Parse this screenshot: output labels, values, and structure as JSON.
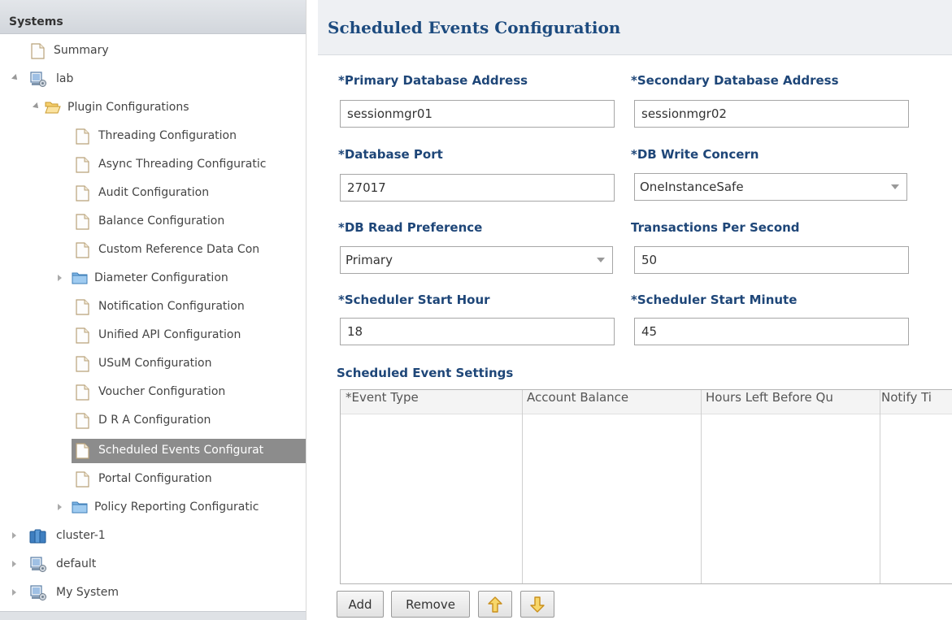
{
  "tree": {
    "header": "Systems",
    "items": [
      {
        "label": "Summary",
        "icon": "document-icon",
        "expander": "none"
      },
      {
        "label": "lab",
        "icon": "system-icon",
        "expander": "open"
      },
      {
        "label": "Plugin Configurations",
        "icon": "folder-open-icon",
        "expander": "open"
      },
      {
        "label": "Threading Configuration",
        "icon": "document-icon",
        "expander": "none"
      },
      {
        "label": "Async Threading Configuratic",
        "icon": "document-icon",
        "expander": "none"
      },
      {
        "label": "Audit Configuration",
        "icon": "document-icon",
        "expander": "none"
      },
      {
        "label": "Balance Configuration",
        "icon": "document-icon",
        "expander": "none"
      },
      {
        "label": "Custom Reference Data Con",
        "icon": "document-icon",
        "expander": "none"
      },
      {
        "label": "Diameter Configuration",
        "icon": "folder-closed-icon",
        "expander": "closed"
      },
      {
        "label": "Notification Configuration",
        "icon": "document-icon",
        "expander": "none"
      },
      {
        "label": "Unified API Configuration",
        "icon": "document-icon",
        "expander": "none"
      },
      {
        "label": "USuM Configuration",
        "icon": "document-icon",
        "expander": "none"
      },
      {
        "label": "Voucher Configuration",
        "icon": "document-icon",
        "expander": "none"
      },
      {
        "label": "D R A Configuration",
        "icon": "document-icon",
        "expander": "none"
      },
      {
        "label": "Scheduled Events Configurat",
        "icon": "document-icon",
        "expander": "none",
        "selected": true
      },
      {
        "label": "Portal Configuration",
        "icon": "document-icon",
        "expander": "none"
      },
      {
        "label": "Policy Reporting Configuratic",
        "icon": "folder-closed-icon",
        "expander": "closed"
      },
      {
        "label": "cluster-1",
        "icon": "cluster-icon",
        "expander": "closed"
      },
      {
        "label": "default",
        "icon": "system-icon",
        "expander": "closed"
      },
      {
        "label": "My System",
        "icon": "system-icon",
        "expander": "closed"
      }
    ]
  },
  "form": {
    "title": "Scheduled Events Configuration",
    "primary_db_address": {
      "label": "*Primary Database Address",
      "value": "sessionmgr01"
    },
    "secondary_db_address": {
      "label": "*Secondary Database Address",
      "value": "sessionmgr02"
    },
    "db_port": {
      "label": "*Database Port",
      "value": "27017"
    },
    "db_write_concern": {
      "label": "*DB Write Concern",
      "value": "OneInstanceSafe"
    },
    "db_read_preference": {
      "label": "*DB Read Preference",
      "value": "Primary"
    },
    "transactions_per_second": {
      "label": "Transactions Per Second",
      "value": "50"
    },
    "scheduler_start_hour": {
      "label": "*Scheduler Start Hour",
      "value": "18"
    },
    "scheduler_start_minute": {
      "label": "*Scheduler Start Minute",
      "value": "45"
    }
  },
  "settings": {
    "title": "Scheduled Event Settings",
    "columns": [
      "*Event Type",
      "Account Balance",
      "Hours Left Before Qu",
      "Notify Ti"
    ],
    "buttons": {
      "add": "Add",
      "remove": "Remove"
    }
  },
  "colors": {
    "label_blue": "#1e4678",
    "title_blue": "#1d4b7f",
    "selected_row": "#8c8c8c"
  }
}
